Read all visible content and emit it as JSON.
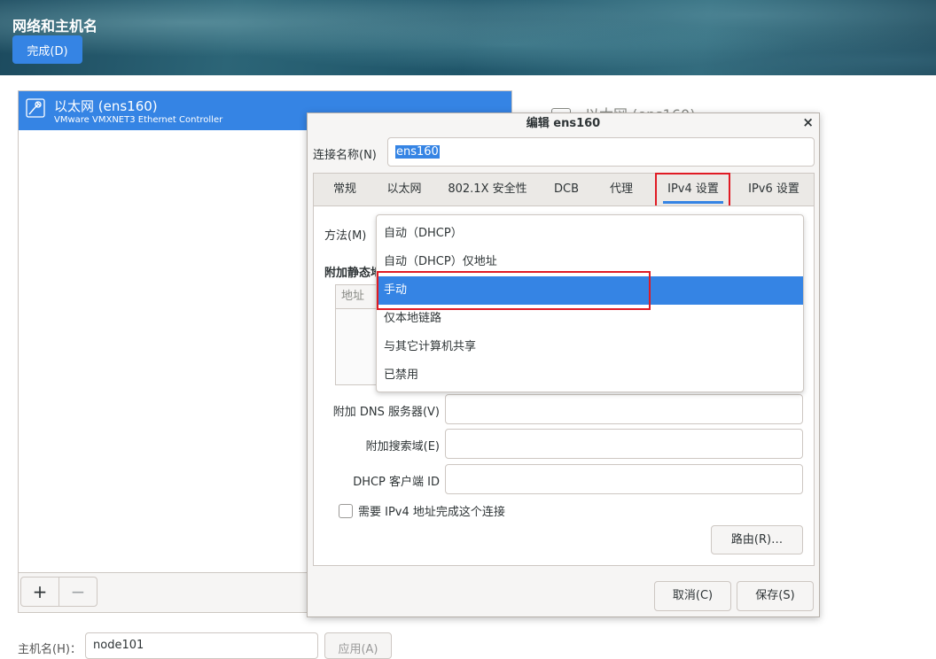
{
  "header": {
    "title": "网络和主机名",
    "done_label": "完成(D)"
  },
  "connections": {
    "items": [
      {
        "name": "以太网 (ens160)",
        "description": "VMware VMXNET3 Ethernet Controller"
      }
    ],
    "add_label": "+",
    "remove_label": "−"
  },
  "detail": {
    "title": "以太网 (ens160)"
  },
  "hostname": {
    "label": "主机名(H)：",
    "value": "node101",
    "apply_label": "应用(A)"
  },
  "dialog": {
    "title": "编辑 ens160",
    "close_label": "×",
    "conn_name_label": "连接名称(N)",
    "conn_name_value": "ens160",
    "tabs": [
      {
        "label": "常规"
      },
      {
        "label": "以太网"
      },
      {
        "label": "802.1X 安全性"
      },
      {
        "label": "DCB"
      },
      {
        "label": "代理"
      },
      {
        "label": "IPv4 设置"
      },
      {
        "label": "IPv6 设置"
      }
    ],
    "active_tab": "IPv4 设置",
    "method_label": "方法(M)",
    "static_label": "附加静态地",
    "address_header": "地址",
    "dns_label": "附加 DNS 服务器(V)",
    "search_label": "附加搜索域(E)",
    "dhcp_id_label": "DHCP 客户端 ID",
    "require_ipv4_label": "需要 IPv4 地址完成这个连接",
    "routes_label": "路由(R)…",
    "cancel_label": "取消(C)",
    "save_label": "保存(S)"
  },
  "method_dropdown": {
    "options": [
      {
        "label": "自动（DHCP）"
      },
      {
        "label": "自动（DHCP）仅地址"
      },
      {
        "label": "手动"
      },
      {
        "label": "仅本地链路"
      },
      {
        "label": "与其它计算机共享"
      },
      {
        "label": "已禁用"
      }
    ],
    "selected": "手动"
  },
  "colors": {
    "accent": "#3584e4",
    "highlight_box": "#e01b24"
  }
}
